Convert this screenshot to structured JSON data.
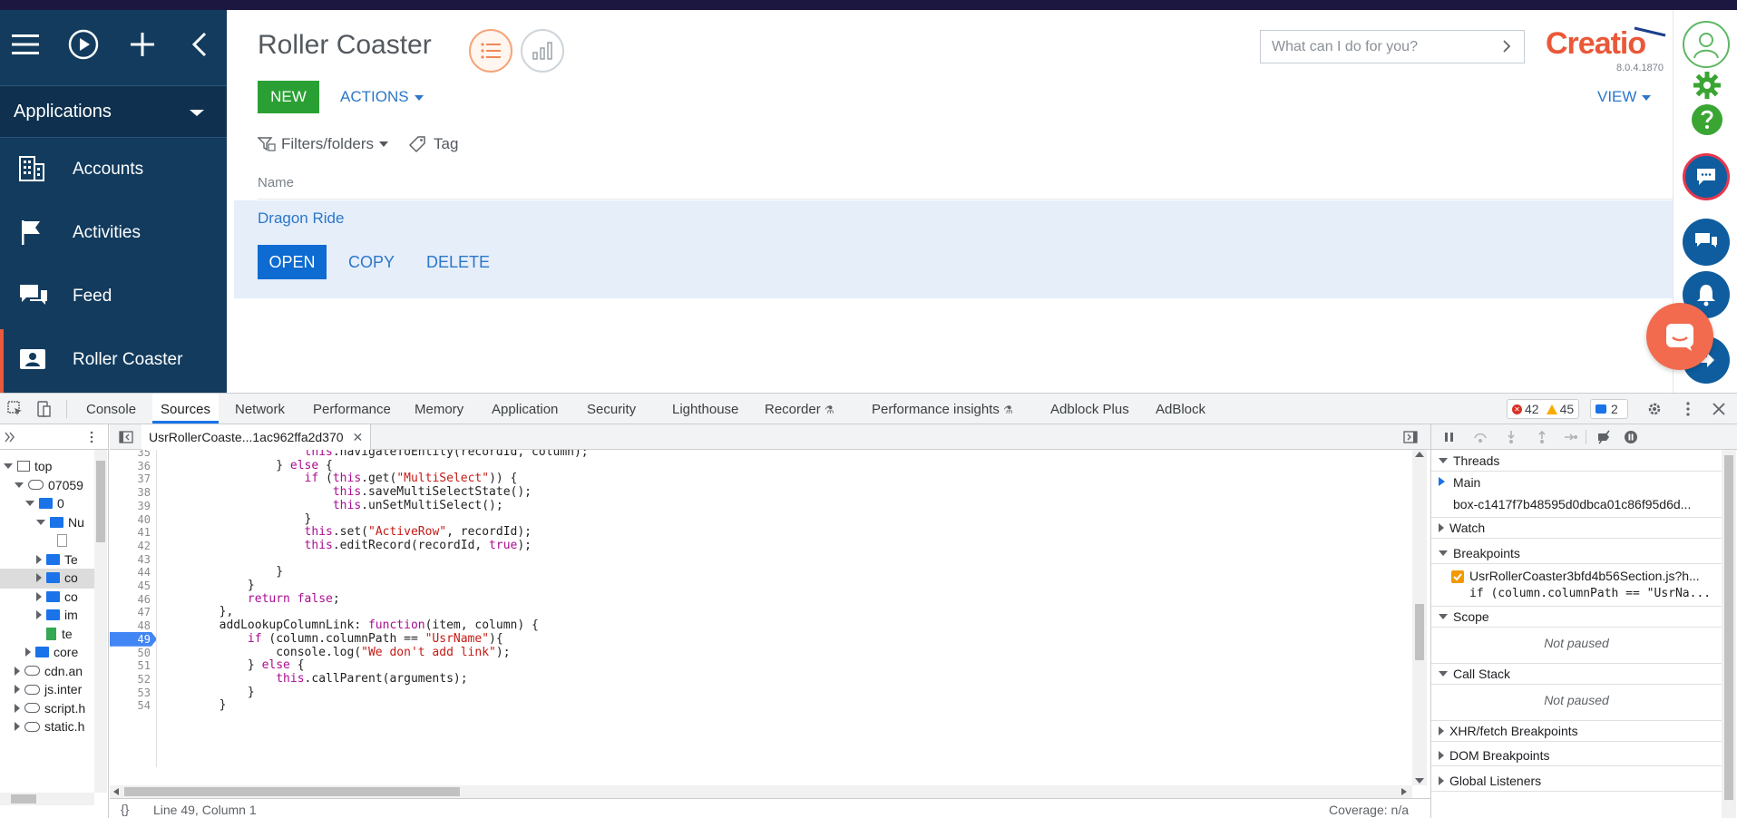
{
  "nav": {
    "applications_label": "Applications",
    "items": [
      {
        "label": "Accounts",
        "icon": "building-icon"
      },
      {
        "label": "Activities",
        "icon": "flag-icon"
      },
      {
        "label": "Feed",
        "icon": "chat-bubbles-icon"
      },
      {
        "label": "Roller Coaster",
        "icon": "contact-card-icon"
      }
    ]
  },
  "page": {
    "title": "Roller Coaster",
    "new_label": "NEW",
    "actions_label": "ACTIONS",
    "view_label": "VIEW",
    "filters_label": "Filters/folders",
    "tag_label": "Tag",
    "column_header": "Name",
    "search_placeholder": "What can I do for you?",
    "logo": "Creatio",
    "version": "8.0.4.1870",
    "colors": {
      "accent": "#ea5838",
      "new_button": "#2aa034",
      "open_button": "#0d6bd1",
      "selected_row": "#e6eefa",
      "nav_bg": "#123b5e"
    }
  },
  "rows": [
    {
      "name": "Dragon Ride",
      "open": "OPEN",
      "copy": "COPY",
      "delete": "DELETE"
    }
  ],
  "devtools": {
    "tabs": [
      "Console",
      "Sources",
      "Network",
      "Performance",
      "Memory",
      "Application",
      "Security",
      "Lighthouse",
      "Recorder",
      "Performance insights",
      "Adblock Plus",
      "AdBlock"
    ],
    "active_tab": "Sources",
    "errors": "42",
    "warnings": "45",
    "messages": "2",
    "file_tab": "UsrRollerCoaste...1ac962ffa2d370",
    "status_position": "Line 49, Column 1",
    "status_braces": "{}",
    "coverage": "Coverage: n/a",
    "tree": [
      {
        "label": "top",
        "kind": "frame",
        "indent": 0,
        "open": true
      },
      {
        "label": "07059",
        "kind": "cloud",
        "indent": 1,
        "open": true
      },
      {
        "label": "0",
        "kind": "folder",
        "indent": 2,
        "open": true
      },
      {
        "label": "Nu",
        "kind": "folder",
        "indent": 3,
        "open": true
      },
      {
        "label": "",
        "kind": "file-selected",
        "indent": 4,
        "open": false
      },
      {
        "label": "Te",
        "kind": "folder",
        "indent": 3,
        "open": false
      },
      {
        "label": "co",
        "kind": "folder",
        "indent": 3,
        "open": false
      },
      {
        "label": "co",
        "kind": "folder",
        "indent": 3,
        "open": false
      },
      {
        "label": "im",
        "kind": "folder",
        "indent": 3,
        "open": false
      },
      {
        "label": "te",
        "kind": "file",
        "indent": 3,
        "open": false
      },
      {
        "label": "core",
        "kind": "folder",
        "indent": 2,
        "open": false
      },
      {
        "label": "cdn.an",
        "kind": "cloud",
        "indent": 1,
        "open": false
      },
      {
        "label": "js.inter",
        "kind": "cloud",
        "indent": 1,
        "open": false
      },
      {
        "label": "script.h",
        "kind": "cloud",
        "indent": 1,
        "open": false
      },
      {
        "label": "static.h",
        "kind": "cloud",
        "indent": 1,
        "open": false
      }
    ],
    "code_lines": [
      {
        "n": "35",
        "text": "                    this.navigateToEntity(recordId, column);"
      },
      {
        "n": "36",
        "text": "                } else {"
      },
      {
        "n": "37",
        "text": "                    if (this.get(\"MultiSelect\")) {"
      },
      {
        "n": "38",
        "text": "                        this.saveMultiSelectState();"
      },
      {
        "n": "39",
        "text": "                        this.unSetMultiSelect();"
      },
      {
        "n": "40",
        "text": "                    }"
      },
      {
        "n": "41",
        "text": "                    this.set(\"ActiveRow\", recordId);"
      },
      {
        "n": "42",
        "text": "                    this.editRecord(recordId, true);"
      },
      {
        "n": "43",
        "text": ""
      },
      {
        "n": "44",
        "text": "                }"
      },
      {
        "n": "45",
        "text": "            }"
      },
      {
        "n": "46",
        "text": "            return false;"
      },
      {
        "n": "47",
        "text": "        },"
      },
      {
        "n": "48",
        "text": "        addLookupColumnLink: function(item, column) {"
      },
      {
        "n": "49",
        "text": "            if (column.columnPath == \"UsrName\"){"
      },
      {
        "n": "50",
        "text": "                console.log(\"We don't add link\");"
      },
      {
        "n": "51",
        "text": "            } else {"
      },
      {
        "n": "52",
        "text": "                this.callParent(arguments);"
      },
      {
        "n": "53",
        "text": "            }"
      },
      {
        "n": "54",
        "text": "        }"
      }
    ],
    "breakpoint_line": "49",
    "sidebar": {
      "threads": "Threads",
      "main_thread": "Main",
      "thread_url": "box-c1417f7b48595d0dbca01c86f95d6d...",
      "watch": "Watch",
      "breakpoints": "Breakpoints",
      "bp_file": "UsrRollerCoaster3bfd4b56Section.js?h...",
      "bp_code": "if (column.columnPath == \"UsrNa...",
      "scope": "Scope",
      "not_paused_1": "Not paused",
      "call_stack": "Call Stack",
      "not_paused_2": "Not paused",
      "xhr": "XHR/fetch Breakpoints",
      "dom": "DOM Breakpoints",
      "global": "Global Listeners"
    }
  }
}
